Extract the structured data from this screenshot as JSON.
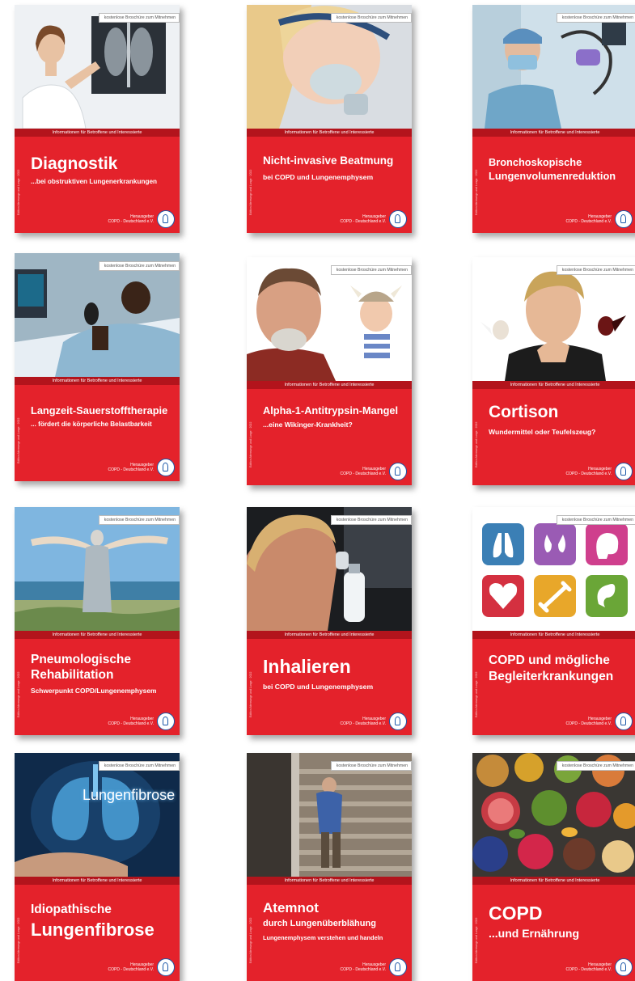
{
  "common": {
    "badge": "kostenlose Broschüre zum Mitnehmen",
    "band": "Informationen für Betroffene und Interessierte",
    "pub_label": "Herausgeber",
    "pub_org": "COPD - Deutschland e.V.",
    "side_text": "Edition Atemwege und Lunge · 2022"
  },
  "brochures": [
    {
      "title": "Diagnostik",
      "subtitle": "...bei obstruktiven Lungenerkrankungen",
      "image": "doctor-xray-photo"
    },
    {
      "title": "Nicht-invasive Beatmung",
      "subtitle": "bei COPD und Lungenemphysem",
      "image": "breathing-mask-photo"
    },
    {
      "title": "Bronchoskopische Lungenvolumenreduktion",
      "subtitle": "",
      "image": "surgeon-bronchoscope-photo"
    },
    {
      "title": "Langzeit-Sauerstofftherapie",
      "subtitle": "... fördert die körperliche Belastbarkeit",
      "image": "patient-bed-photo"
    },
    {
      "title": "Alpha-1-Antitrypsin-Mangel",
      "subtitle": "...eine Wikinger-Krankheit?",
      "image": "man-and-viking-baby-photo"
    },
    {
      "title": "Cortison",
      "subtitle": "Wundermittel oder Teufelszeug?",
      "image": "man-angel-devil-photo"
    },
    {
      "title": "Pneumologische Rehabilitation",
      "subtitle": "Schwerpunkt COPD/Lungenemphysem",
      "image": "woman-beach-photo"
    },
    {
      "title": "Inhalieren",
      "subtitle": "bei COPD und Lungenemphysem",
      "image": "woman-inhaler-photo"
    },
    {
      "title": "COPD und mögliche Begleiterkrankungen",
      "subtitle": "",
      "image": "organ-icons"
    },
    {
      "title_small": "Idiopathische",
      "title": "Lungenfibrose",
      "subtitle": "",
      "image_label": "Lungenfibrose",
      "image": "lungs-hand-photo"
    },
    {
      "title": "Atemnot",
      "subtitle": "durch Lungenüberblähung",
      "subtitle2": "Lungenemphysem verstehen und handeln",
      "image": "man-stairs-photo"
    },
    {
      "title": "COPD",
      "subtitle": "...und Ernährung",
      "image": "food-bowls-photo"
    }
  ]
}
